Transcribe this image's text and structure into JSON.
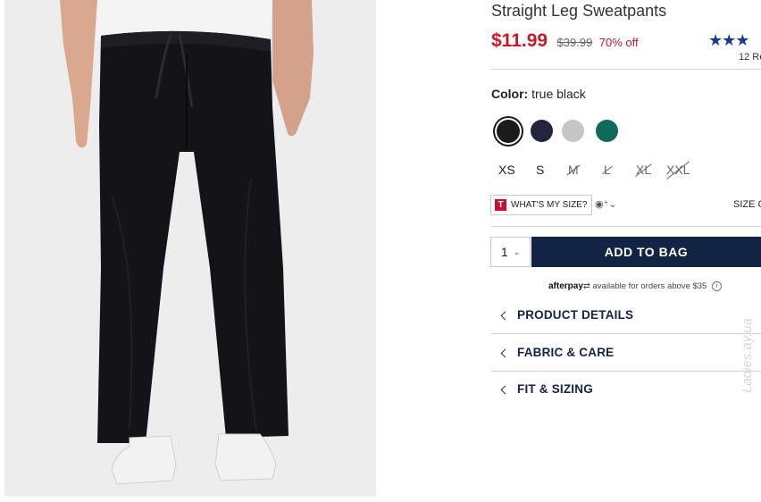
{
  "product": {
    "title": "Straight Leg Sweatpants",
    "sale_price": "$11.99",
    "original_price": "$39.99",
    "discount": "70% off",
    "stars": "★★★",
    "reviews": "12 Re"
  },
  "color": {
    "label": "Color:",
    "value": "true black",
    "swatches": [
      {
        "name": "true black",
        "hex": "#1b1b1b",
        "selected": true
      },
      {
        "name": "navy",
        "hex": "#23253d",
        "selected": false
      },
      {
        "name": "light heather gray",
        "hex": "#c6c6c6",
        "selected": false
      },
      {
        "name": "green",
        "hex": "#0f6a5c",
        "selected": false
      }
    ]
  },
  "sizes": [
    {
      "label": "XS",
      "available": true
    },
    {
      "label": "S",
      "available": true
    },
    {
      "label": "M",
      "available": false
    },
    {
      "label": "L",
      "available": false
    },
    {
      "label": "XL",
      "available": false
    },
    {
      "label": "XXL",
      "available": false
    }
  ],
  "fit": {
    "whats_my_size": "WHAT'S MY SIZE?",
    "size_chart": "SIZE C"
  },
  "cart": {
    "quantity": "1",
    "add_to_bag": "ADD TO BAG"
  },
  "afterpay": {
    "brand": "afterpay",
    "text": "available for orders above $35"
  },
  "accordion": [
    {
      "label": "PRODUCT DETAILS"
    },
    {
      "label": "FABRIC & CARE"
    },
    {
      "label": "FIT & SIZING"
    }
  ],
  "watermark": "Ladies.ay.ua"
}
